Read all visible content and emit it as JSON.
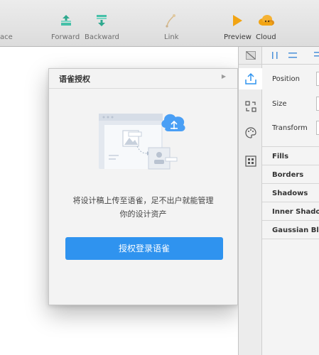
{
  "toolbar": {
    "partial_label": "ace",
    "forward_label": "Forward",
    "backward_label": "Backward",
    "link_label": "Link",
    "preview_label": "Preview",
    "cloud_label": "Cloud"
  },
  "popover": {
    "title": "语雀授权",
    "description_line1": "将设计稿上传至语雀，足不出户就能管理",
    "description_line2": "你的设计资产",
    "button_label": "授权登录语雀"
  },
  "inspector": {
    "position_label": "Position",
    "size_label": "Size",
    "transform_label": "Transform",
    "fills_label": "Fills",
    "borders_label": "Borders",
    "shadows_label": "Shadows",
    "inner_shadows_label": "Inner Shado",
    "gaussian_blur_label": "Gaussian Bl"
  },
  "colors": {
    "accent": "#2f93ef",
    "preview_orange": "#f2a413"
  }
}
